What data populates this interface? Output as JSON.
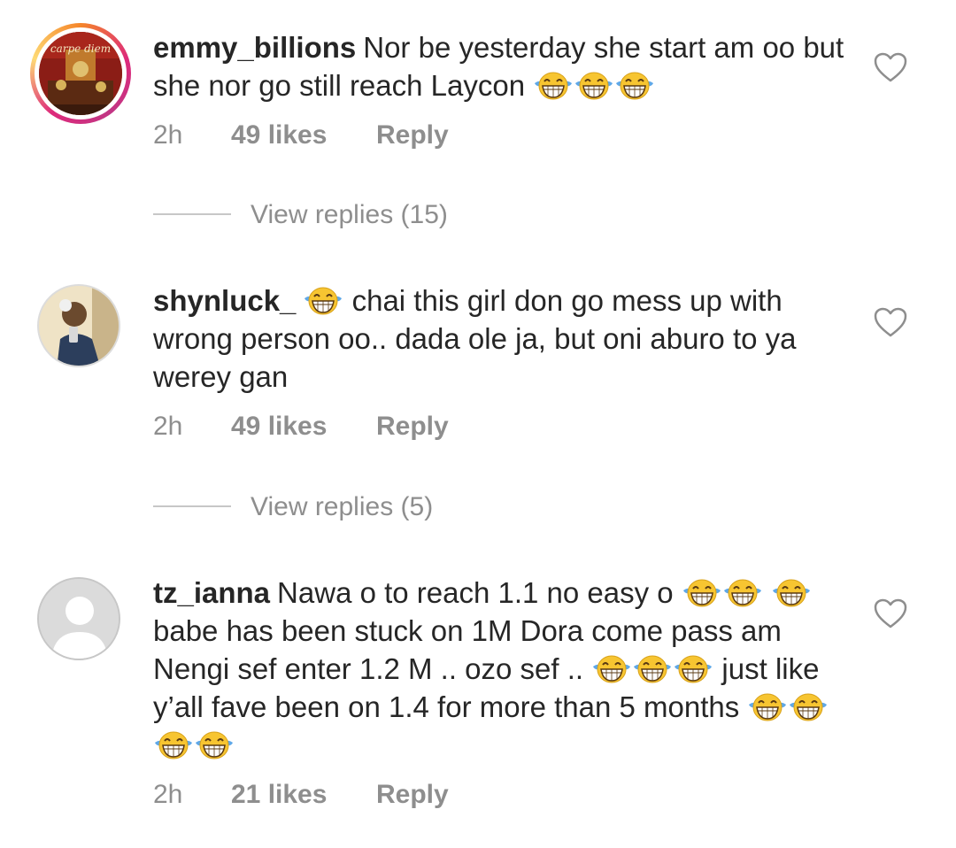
{
  "comments": [
    {
      "username": "emmy_billions",
      "text": "Nor be yesterday she start am oo but she nor go still reach Laycon",
      "avatar_caption": "carpe diem",
      "time": "2h",
      "likes": "49 likes",
      "reply_label": "Reply",
      "view_replies": "View replies (15)"
    },
    {
      "username": "shynluck_",
      "text_after_emoji": "chai this girl don go mess up with wrong person oo.. dada ole ja, but oni aburo to ya werey gan",
      "time": "2h",
      "likes": "49 likes",
      "reply_label": "Reply",
      "view_replies": "View replies (5)"
    },
    {
      "username": "tz_ianna",
      "text_part1": "Nawa o to reach 1.1 no easy o",
      "text_part2": "babe has been stuck on 1M Dora come pass am Nengi sef enter 1.2 M .. ozo sef ..",
      "text_part3": "just like y’all fave been on 1.4 for more than 5 months",
      "time": "2h",
      "likes": "21 likes",
      "reply_label": "Reply"
    }
  ],
  "icons": {
    "like": "heart-outline-icon",
    "emoji": "laughing-tears-emoji",
    "default_avatar": "default-avatar-icon"
  },
  "colors": {
    "text": "#262626",
    "secondary": "#8e8e8e",
    "emoji_yellow": "#f5c518"
  }
}
